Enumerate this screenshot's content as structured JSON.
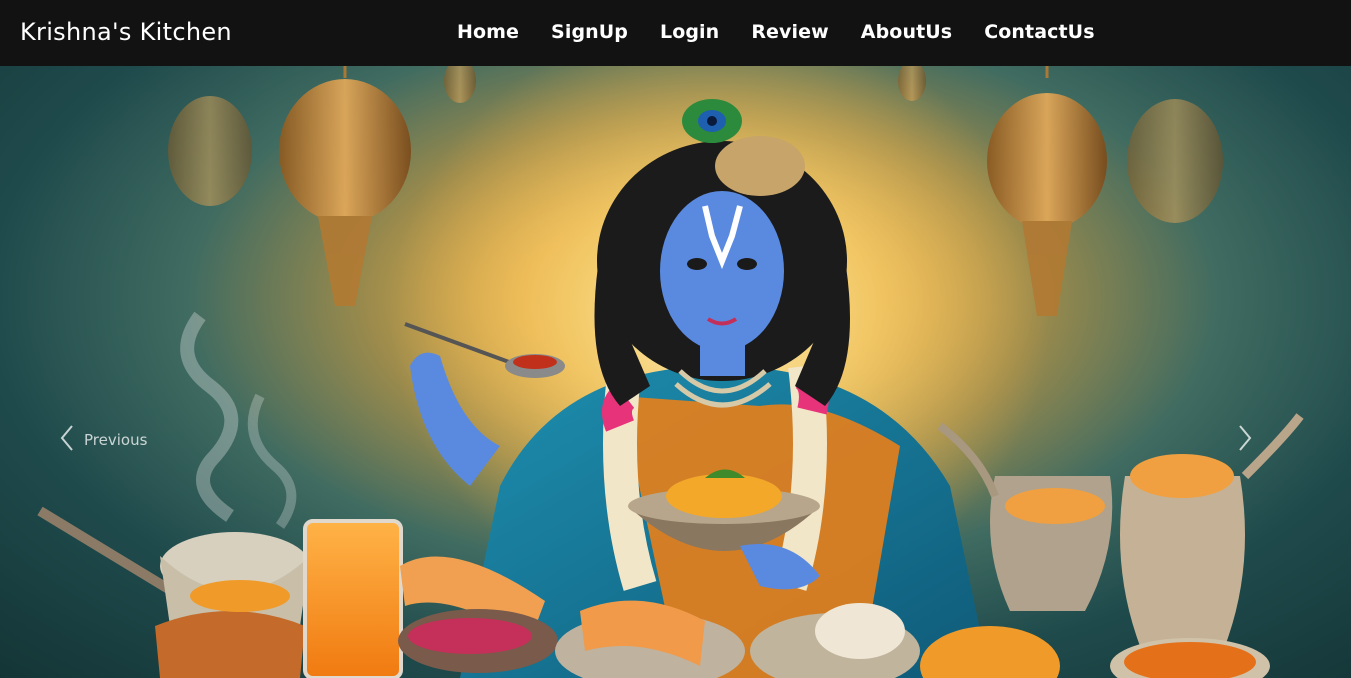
{
  "brand": {
    "name": "Krishna's Kitchen"
  },
  "nav": {
    "items": [
      {
        "label": "Home"
      },
      {
        "label": "SignUp"
      },
      {
        "label": "Login"
      },
      {
        "label": "Review"
      },
      {
        "label": "AboutUs"
      },
      {
        "label": "ContactUs"
      }
    ]
  },
  "carousel": {
    "prev_label": "Previous",
    "prev_icon": "chevron-left-icon",
    "next_icon": "chevron-right-icon",
    "slide_image": "krishna-feast-illustration"
  },
  "colors": {
    "navbar_bg": "#121212",
    "nav_text": "#ffffff"
  }
}
